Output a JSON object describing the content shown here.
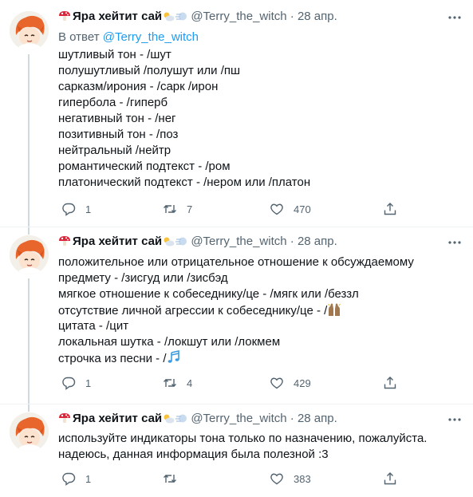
{
  "tweets": [
    {
      "name": "Яра хейтит сай",
      "handle": "@Terry_the_witch",
      "dot": "·",
      "date": "28 апр.",
      "reply_prefix": "В ответ",
      "reply_mention": "@Terry_the_witch",
      "lines": [
        "шутливый тон - /шут",
        "полушутливый /полушут или /пш",
        "сарказм/ирония - /сарк /ирон",
        "гипербола - /гиперб",
        "негативный тон - /нег",
        "позитивный тон - /поз",
        "нейтральный /нейтр",
        "романтический подтекст - /ром",
        "платонический подтекст - /нером или /платон"
      ],
      "replies": "1",
      "retweets": "7",
      "likes": "470"
    },
    {
      "name": "Яра хейтит сай",
      "handle": "@Terry_the_witch",
      "dot": "·",
      "date": "28 апр.",
      "lines": [
        "положительное или отрицательное отношение к обсуждаемому",
        "предмету - /зисгуд или /зисбэд",
        "мягкое отношение к собеседнику/це - /мягк или /беззл",
        "отсутствие личной агрессии к собеседнику/це - /",
        "цитата - /цит",
        "локальная шутка - /локшут или /локмем",
        "строчка из песни - /"
      ],
      "replies": "1",
      "retweets": "4",
      "likes": "429"
    },
    {
      "name": "Яра хейтит сай",
      "handle": "@Terry_the_witch",
      "dot": "·",
      "date": "28 апр.",
      "lines": [
        "используйте индикаторы тона только по назначению, пожалуйста.",
        "надеюсь, данная информация была полезной :3"
      ],
      "replies": "1",
      "retweets": "",
      "likes": "383"
    }
  ],
  "icons": {
    "name_prefix": "mushroom-icon",
    "name_suffix": [
      "sun-behind-cloud-icon",
      "dash-icon"
    ],
    "actions": [
      "reply-icon",
      "retweet-icon",
      "like-icon",
      "share-icon"
    ],
    "more": "more-icon",
    "inline": [
      "raised-hands-icon",
      "musical-notes-icon"
    ]
  },
  "colors": {
    "text": "#0f1419",
    "secondary": "#536471",
    "link": "#1d9bf0",
    "divider": "#eff3f4",
    "thread_line": "#cfd9de"
  }
}
